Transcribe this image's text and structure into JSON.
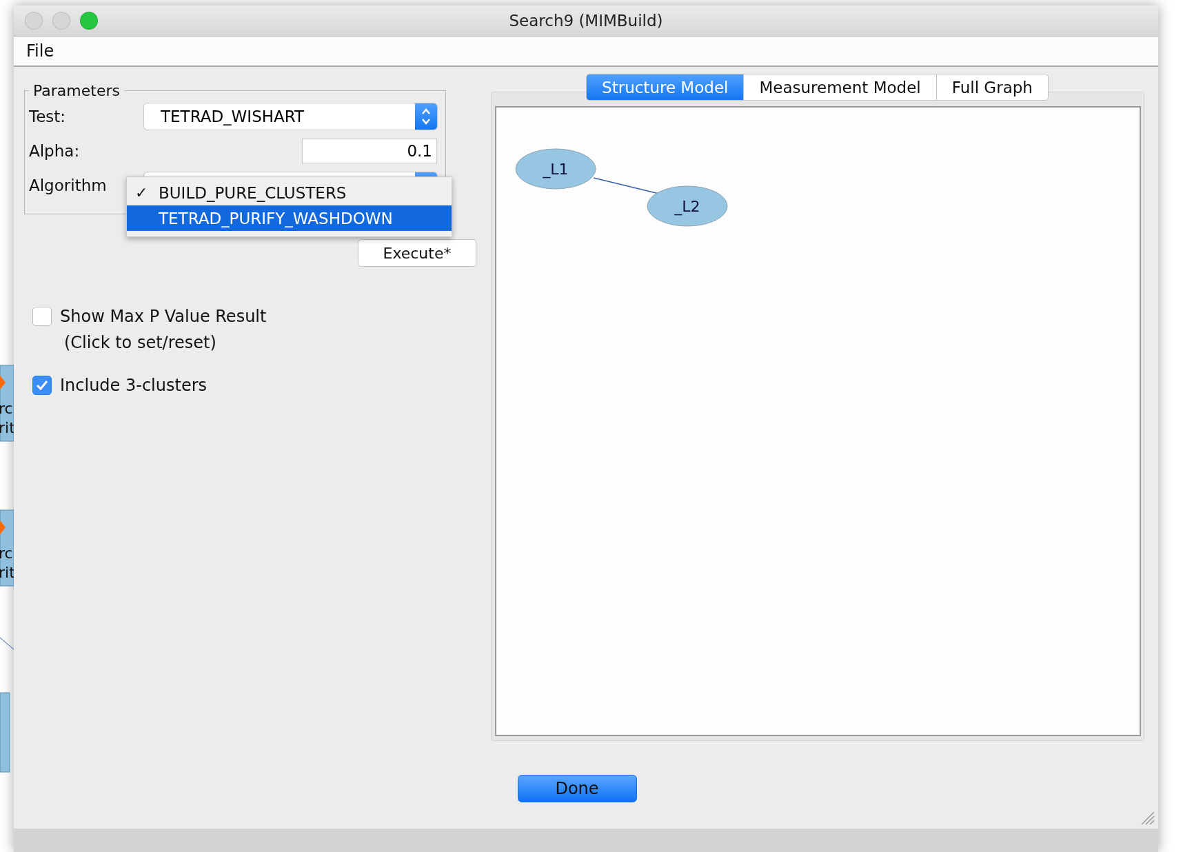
{
  "background_window": {
    "nodes": [
      {
        "lines": [
          "rc",
          "rit"
        ]
      },
      {
        "lines": [
          "rc",
          "rit"
        ]
      }
    ]
  },
  "window": {
    "title": "Search9 (MIMBuild)",
    "buttons": [
      {
        "kind": "close",
        "active": false
      },
      {
        "kind": "minimize",
        "active": false
      },
      {
        "kind": "zoom",
        "active": true
      }
    ]
  },
  "menu": [
    "File"
  ],
  "parameters": {
    "title": "Parameters",
    "test": {
      "label": "Test:",
      "value": "TETRAD_WISHART"
    },
    "alpha": {
      "label": "Alpha:",
      "value": "0.1"
    },
    "algorithm": {
      "label": "Algorithm",
      "open": true,
      "check_glyph": "✓",
      "options": [
        {
          "label": "BUILD_PURE_CLUSTERS",
          "checked": true,
          "selected": false
        },
        {
          "label": "TETRAD_PURIFY_WASHDOWN",
          "checked": false,
          "selected": true
        }
      ]
    }
  },
  "execute_button": "Execute*",
  "options": [
    {
      "label": "Show Max P Value Result",
      "note": "(Click to set/reset)",
      "checked": false
    },
    {
      "label": "Include 3-clusters",
      "checked": true
    }
  ],
  "tabs": [
    {
      "label": "Structure Model",
      "selected": true
    },
    {
      "label": "Measurement Model",
      "selected": false
    },
    {
      "label": "Full Graph",
      "selected": false
    }
  ],
  "graph": {
    "nodes": [
      {
        "label": "_L1",
        "connected": true
      },
      {
        "label": "_L2",
        "connected": true
      }
    ]
  },
  "done_button": "Done"
}
